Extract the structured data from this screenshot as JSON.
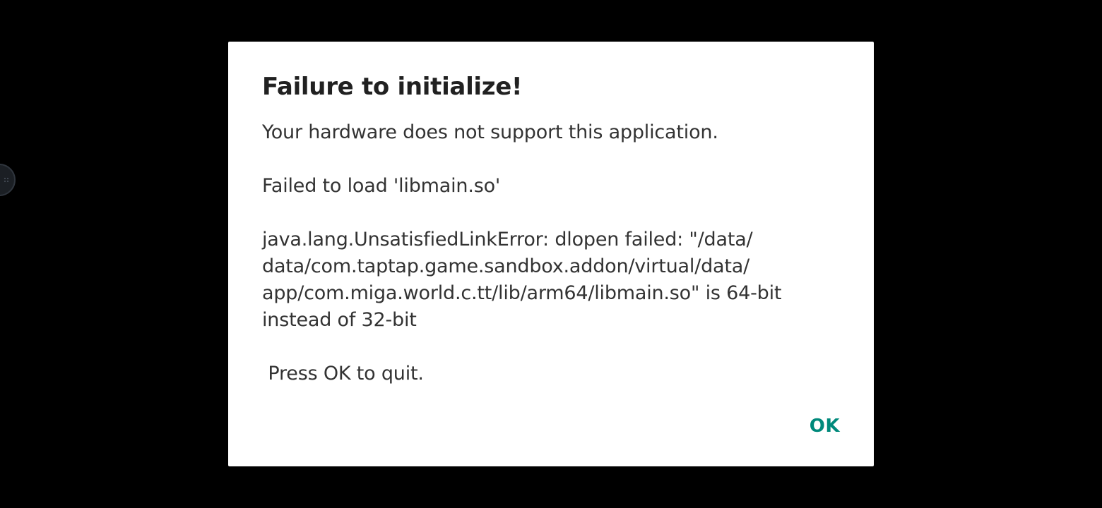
{
  "dialog": {
    "title": "Failure to initialize!",
    "message": "Your hardware does not support this application.\n\nFailed to load 'libmain.so'\n\njava.lang.UnsatisfiedLinkError: dlopen failed: \"/data/\ndata/com.taptap.game.sandbox.addon/virtual/data/\napp/com.miga.world.c.tt/lib/arm64/libmain.so\" is 64-bit\ninstead of 32-bit\n\n Press OK to quit.",
    "ok_label": "OK"
  },
  "colors": {
    "background": "#000000",
    "dialog_bg": "#ffffff",
    "title": "#212121",
    "body_text": "#333333",
    "accent": "#00897b"
  },
  "floating_button": {
    "icon": "grid-dots-icon"
  }
}
